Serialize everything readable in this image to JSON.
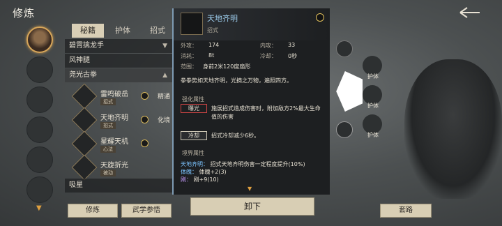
{
  "header": {
    "title": "修炼"
  },
  "tabs": [
    "秘籍",
    "护体",
    "招式"
  ],
  "categories": {
    "top": [
      "碧霄擒龙手",
      "风神腿",
      "尧光古拳"
    ],
    "bottom": "吸星"
  },
  "skills": [
    {
      "name": "雷鸣破岳",
      "tag": "招式",
      "status": "精通"
    },
    {
      "name": "天地齐明",
      "tag": "招式",
      "status": "化境"
    },
    {
      "name": "星耀天机",
      "tag": "心法",
      "status": ""
    },
    {
      "name": "天旋折光",
      "tag": "被动",
      "status": ""
    }
  ],
  "detail": {
    "name": "天地齐明",
    "type": "招式",
    "stats": {
      "waigong_label": "外攻：",
      "waigong": "174",
      "neigong_label": "内攻：",
      "neigong": "33",
      "cost_label": "消耗：",
      "cost": "8t",
      "cooldown_label": "冷却：",
      "cooldown": "0秒",
      "range_label": "范围：",
      "range": "身前2米120度扇形"
    },
    "desc": "拳拳势如天地齐明，光摘之万物，遍照四方。",
    "section1": "强化属性",
    "kw1": "曝光",
    "kw1_desc": "施展招式造成伤害时，附加敌方2%最大生命值的伤害",
    "kw2": "冷却",
    "kw2_desc": "招式冷却减少6秒。",
    "section2": "境界属性",
    "realm1_name": "天地齐明：",
    "realm1_text": "招式天地齐明伤害一定程度提升(10%)",
    "realm2_name": "体魄：",
    "realm2_text": "体魄+2(3)",
    "realm3_name": "刚：",
    "realm3_text": "刚+9(10)"
  },
  "buttons": {
    "unload": "卸下",
    "cultivate": "修炼",
    "wuxue": "武学参悟",
    "taolu": "套路"
  },
  "right_slots": [
    "护体",
    "护体",
    "护体"
  ]
}
